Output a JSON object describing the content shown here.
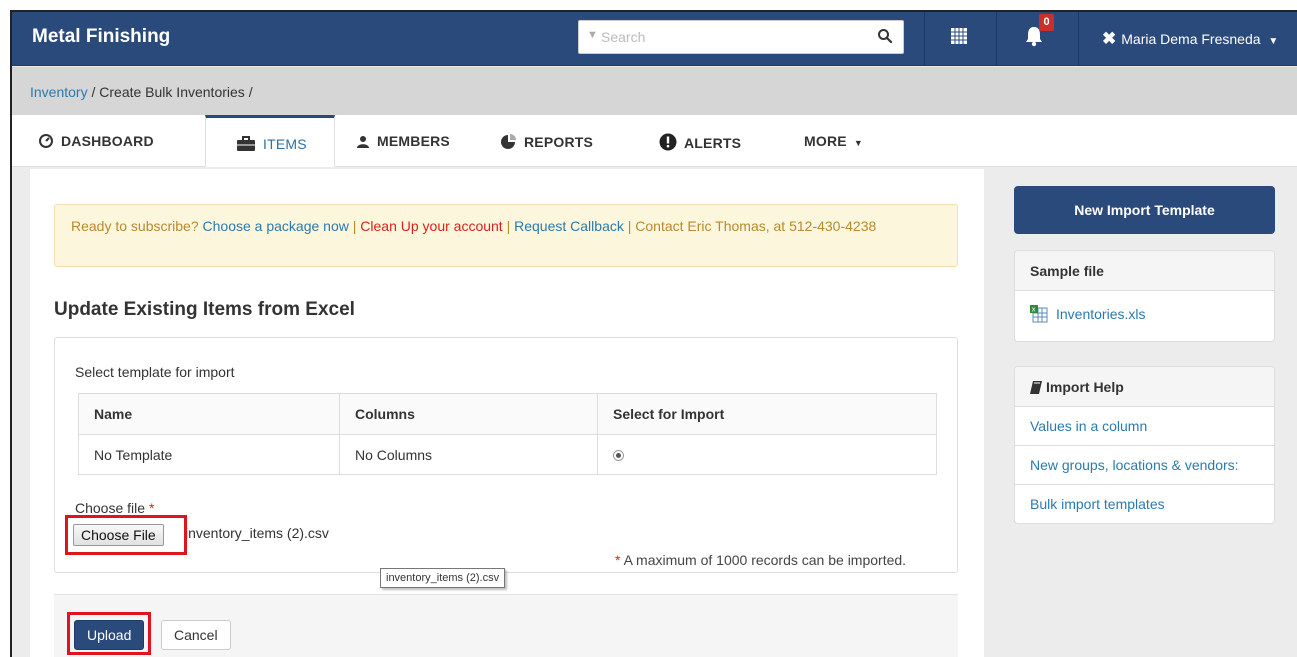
{
  "app": {
    "title": "Metal Finishing"
  },
  "search": {
    "placeholder": "Search"
  },
  "notifications": {
    "count": "0"
  },
  "user": {
    "name": "Maria Dema Fresneda"
  },
  "breadcrumb": {
    "parent": "Inventory",
    "current": "Create Bulk Inventories",
    "separator": "/"
  },
  "tabs": [
    {
      "label": "DASHBOARD",
      "icon": "dashboard-icon"
    },
    {
      "label": "ITEMS",
      "icon": "briefcase-icon",
      "active": true
    },
    {
      "label": "MEMBERS",
      "icon": "user-icon"
    },
    {
      "label": "REPORTS",
      "icon": "pie-chart-icon"
    },
    {
      "label": "ALERTS",
      "icon": "exclamation-icon"
    },
    {
      "label": "MORE",
      "icon": "caret-down-icon"
    }
  ],
  "alert": {
    "prefix": "Ready to subscribe?",
    "choose_package": "Choose a package now",
    "clean_up": "Clean Up your account",
    "request_callback": "Request Callback",
    "contact": "Contact Eric Thomas, at 512-430-4238",
    "divider": "|"
  },
  "page": {
    "title": "Update Existing Items from Excel"
  },
  "import_form": {
    "select_label": "Select template for import",
    "columns": [
      "Name",
      "Columns",
      "Select for Import"
    ],
    "rows": [
      {
        "name": "No Template",
        "columns": "No Columns",
        "selected": true
      }
    ],
    "choose_file_label": "Choose file",
    "required_mark": "*",
    "choose_file_button": "Choose File",
    "file_name": "inventory_items (2).csv",
    "max_note": "A maximum of 1000 records can be imported.",
    "tooltip": "inventory_items (2).csv",
    "upload": "Upload",
    "cancel": "Cancel"
  },
  "sidebar": {
    "new_template": "New Import Template",
    "sample": {
      "title": "Sample file",
      "file": "Inventories.xls"
    },
    "help": {
      "title": "Import Help",
      "links": [
        "Values in a column",
        "New groups, locations & vendors:",
        "Bulk import templates"
      ]
    }
  },
  "colors": {
    "navbar": "#2a4a7c",
    "link": "#2a7ab0",
    "highlight": "#e0141e"
  }
}
